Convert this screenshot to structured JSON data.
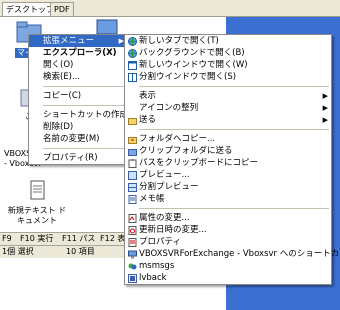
{
  "tabs": [
    "デスクトップ",
    "PDF"
  ],
  "desktop_icons": [
    "マイド",
    "こ",
    "VBOXSVR\n- Vboxsvr",
    "新規テキスト ド\nキュメント"
  ],
  "status_bar": {
    "keys": [
      "F9",
      "F10 実行",
      "F11 パス",
      "F12 表示"
    ],
    "info": [
      "1個 選択",
      "10 項目"
    ]
  },
  "context_menu": {
    "items": [
      {
        "label": "拡張メニュー",
        "highlight": true,
        "submenu": true
      },
      {
        "label": "エクスプローラ(X)",
        "bold": true
      },
      {
        "label": "開く(O)"
      },
      {
        "label": "検索(E)..."
      },
      {
        "sep": true
      },
      {
        "label": "コピー(C)"
      },
      {
        "sep": true
      },
      {
        "label": "ショートカットの作成(S)"
      },
      {
        "label": "削除(D)"
      },
      {
        "label": "名前の変更(M)"
      },
      {
        "sep": true
      },
      {
        "label": "プロパティ(R)"
      }
    ]
  },
  "submenu": {
    "items": [
      {
        "label": "新しいタブで開く(T)",
        "icon": "globe-icon"
      },
      {
        "label": "バックグラウンドで開く(B)",
        "icon": "globe-icon"
      },
      {
        "label": "新しいウインドウで開く(W)",
        "icon": "window-icon"
      },
      {
        "label": "分割ウインドウで開く(S)",
        "icon": "split-window-icon"
      },
      {
        "sep": true
      },
      {
        "label": "表示",
        "submenu": true
      },
      {
        "label": "アイコンの整列",
        "submenu": true
      },
      {
        "label": "送る",
        "icon": "folder-icon",
        "submenu": true
      },
      {
        "sep": true
      },
      {
        "label": "フォルダへコピー...",
        "icon": "copy-folder-icon"
      },
      {
        "label": "クリップフォルダに送る",
        "icon": "clip-folder-icon"
      },
      {
        "label": "パスをクリップボードにコピー",
        "icon": "clipboard-icon"
      },
      {
        "label": "プレビュー...",
        "icon": "preview-icon"
      },
      {
        "label": "分割プレビュー",
        "icon": "split-preview-icon"
      },
      {
        "label": "メモ帳",
        "icon": "notepad-icon"
      },
      {
        "sep": true
      },
      {
        "label": "属性の変更...",
        "icon": "attribute-icon"
      },
      {
        "label": "更新日時の変更...",
        "icon": "clock-icon"
      },
      {
        "label": "プロパティ",
        "icon": "properties-icon"
      },
      {
        "label": "VBOXSVRForExchange - Vboxsvr へのショートカット",
        "icon": "network-icon"
      },
      {
        "label": "msmsgs",
        "icon": "messenger-icon"
      },
      {
        "label": "lvback",
        "icon": "app-icon"
      }
    ]
  }
}
